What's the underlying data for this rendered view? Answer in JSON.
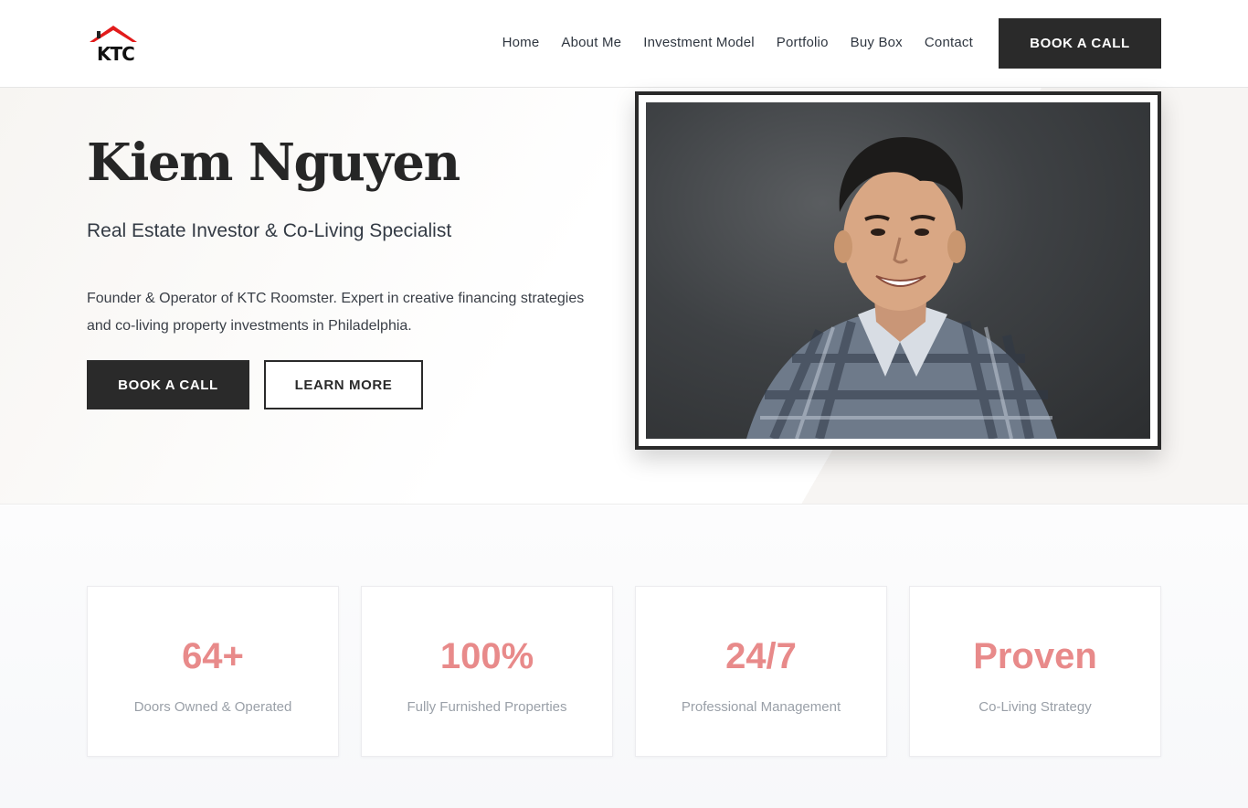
{
  "brand": {
    "logo_text": "KTC",
    "colors": {
      "roof": "#e21b1b",
      "dark": "#2a2a2a",
      "accent": "#e88a8a"
    }
  },
  "nav": {
    "items": [
      {
        "label": "Home"
      },
      {
        "label": "About Me"
      },
      {
        "label": "Investment Model"
      },
      {
        "label": "Portfolio"
      },
      {
        "label": "Buy Box"
      },
      {
        "label": "Contact"
      }
    ],
    "cta_label": "BOOK A CALL"
  },
  "hero": {
    "title": "Kiem Nguyen",
    "subtitle": "Real Estate Investor & Co-Living Specialist",
    "description": "Founder & Operator of KTC Roomster. Expert in creative financing strategies and co-living property investments in Philadelphia.",
    "primary_button": "BOOK A CALL",
    "secondary_button": "LEARN MORE"
  },
  "stats": [
    {
      "value": "64+",
      "label": "Doors Owned & Operated"
    },
    {
      "value": "100%",
      "label": "Fully Furnished Properties"
    },
    {
      "value": "24/7",
      "label": "Professional Management"
    },
    {
      "value": "Proven",
      "label": "Co-Living Strategy"
    }
  ]
}
